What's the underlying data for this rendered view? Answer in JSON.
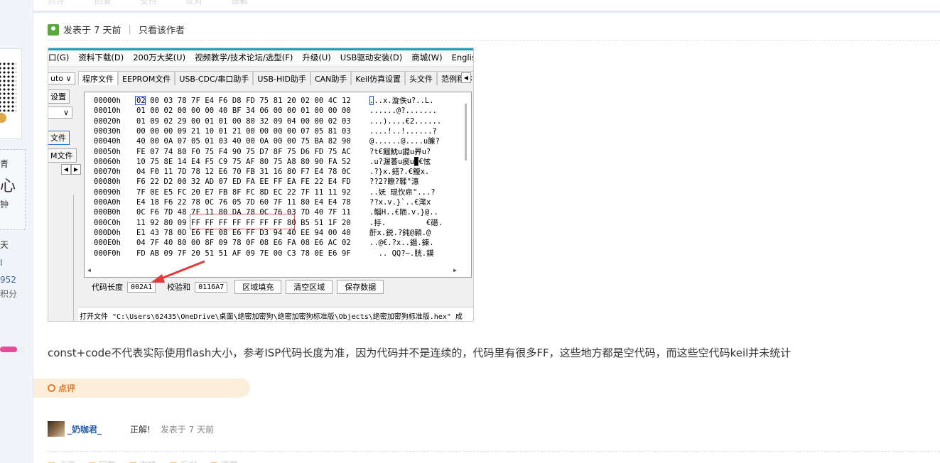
{
  "sidebar": {
    "texts": [
      "青",
      "钟",
      "天",
      "I",
      "952",
      "积分",
      "心"
    ]
  },
  "top_actions": [
    "点评",
    "回复",
    "支持",
    "反对",
    "道歉"
  ],
  "post": {
    "posted_at": "发表于 7 天前",
    "only_author": "只看该作者",
    "body": "const+code不代表实际使用flash大小，参考ISP代码长度为准，因为代码并不是连续的，代码里有很多FF，这些地方都是空代码，而这些空代码keil并未统计"
  },
  "screenshot": {
    "menu": [
      "口(G)",
      "资料下载(D)",
      "200万大奖(U)",
      "视频教学/技术论坛/选型(F)",
      "升级(U)",
      "USB驱动安装(D)",
      "商城(W)",
      "English"
    ],
    "tabs": [
      "程序文件",
      "EEPROM文件",
      "USB-CDC/串口助手",
      "USB-HID助手",
      "CAN助手",
      "Keil仿真设置",
      "头文件",
      "范例程序"
    ],
    "tab_prev": "◀",
    "tab_next": "▶",
    "left_controls": {
      "auto": "uto ∨",
      "settings": "设置",
      "dropdown": "∨",
      "file1": "文件",
      "file2": "M文件"
    },
    "hex_rows": [
      {
        "addr": "00000h",
        "data": "02 00 03 78 7F E4 F6 D8 FD 75 81 20 02 00 4C 12",
        "ascii": "...x.漩佚u?..L."
      },
      {
        "addr": "00010h",
        "data": "01 00 02 00 00 00 40 BF 34 06 00 00 01 00 00 00",
        "ascii": "......@?......."
      },
      {
        "addr": "00020h",
        "data": "01 09 02 29 00 01 01 00 80 32 09 04 00 00 02 03",
        "ascii": "...)....€2......"
      },
      {
        "addr": "00030h",
        "data": "00 00 00 09 21 10 01 21 00 00 00 00 07 05 81 03",
        "ascii": "....!..!......?"
      },
      {
        "addr": "00040h",
        "data": "40 00 0A 07 05 01 03 40 00 0A 00 00 75 BA 82 90",
        "ascii": "@......@....u簾?"
      },
      {
        "addr": "00050h",
        "data": "FE 07 74 80 F0 75 F4 90 75 D7 8F 75 D6 FD 75 AC",
        "ascii": "?t€餾魫u讔u昦u?"
      },
      {
        "addr": "00060h",
        "data": "10 75 8E 14 E4 F5 C9 75 AF 80 75 A8 80 90 FA 52",
        "ascii": ".u?潳萫u瘈u▉€怰"
      },
      {
        "addr": "00070h",
        "data": "04 F0 11 7D 78 12 E6 70 FB 31 16 80 F7 E4 78 0C",
        "ascii": ".?}x.鎝?.€鳆x."
      },
      {
        "addr": "00080h",
        "data": "F6 22 D2 00 32 AD 07 ED FA EE FF EA FE 22 E4 FD",
        "ascii": "??2?瞭?鞣\"潓"
      },
      {
        "addr": "00090h",
        "data": "7F 0E E5 FC 20 E7 FB 8F FC 8D EC 22 7F 11 11 92",
        "ascii": "..妩 琨忺帍\"...?"
      },
      {
        "addr": "000A0h",
        "data": "E4 18 F6 22 78 0C 76 05 7D 60 7F 11 80 E4 E4 78",
        "ascii": "??x.v.}`..€滗x"
      },
      {
        "addr": "000B0h",
        "data": "0C F6 7D 48 7F 11 80 DA 78 0C 76 03 7D 40 7F 11",
        "ascii": ".鲻H..€陑.v.}@.."
      },
      {
        "addr": "000C0h",
        "data": "11 92 80 09 FF FF FF FF FF FF FF 80 B5 51 1F 20",
        "ascii": ".抙.         €礠. "
      },
      {
        "addr": "000D0h",
        "data": "E1 43 78 0D E6 FE 08 E6 FF D3 94 40 EE 94 00 40",
        "ascii": "酑x.鋭.?鈍@顡.@"
      },
      {
        "addr": "000E0h",
        "data": "04 7F 40 80 00 8F 09 78 0F 08 E6 FA 08 E6 AC 02",
        "ascii": "..@€.?x..鐕.鍊."
      },
      {
        "addr": "000F0h",
        "data": "FD AB 09 7F 20 51 51 AF 09 7E 00 C3 78 0E E6 9F",
        "ascii": "  .. QQ?~.胱.鏌"
      }
    ],
    "code_length_label": "代码长度",
    "code_length_value": "002A1",
    "checksum_label": "校验和",
    "checksum_value": "0116A7",
    "btn_fill": "区域填充",
    "btn_clear": "清空区域",
    "btn_save": "保存数据",
    "status": "打开文件 \"C:\\Users\\62435\\OneDrive\\桌面\\绝密加密狗\\绝密加密狗标准版\\Objects\\绝密加密狗标准版.hex\" 成"
  },
  "rate": {
    "label": "点评"
  },
  "comment": {
    "user": "_奶咖君_",
    "content": "正解!",
    "time": "发表于 7 天前"
  },
  "bottom_actions": [
    "点评",
    "回复",
    "支持",
    "反对",
    "道歉"
  ]
}
